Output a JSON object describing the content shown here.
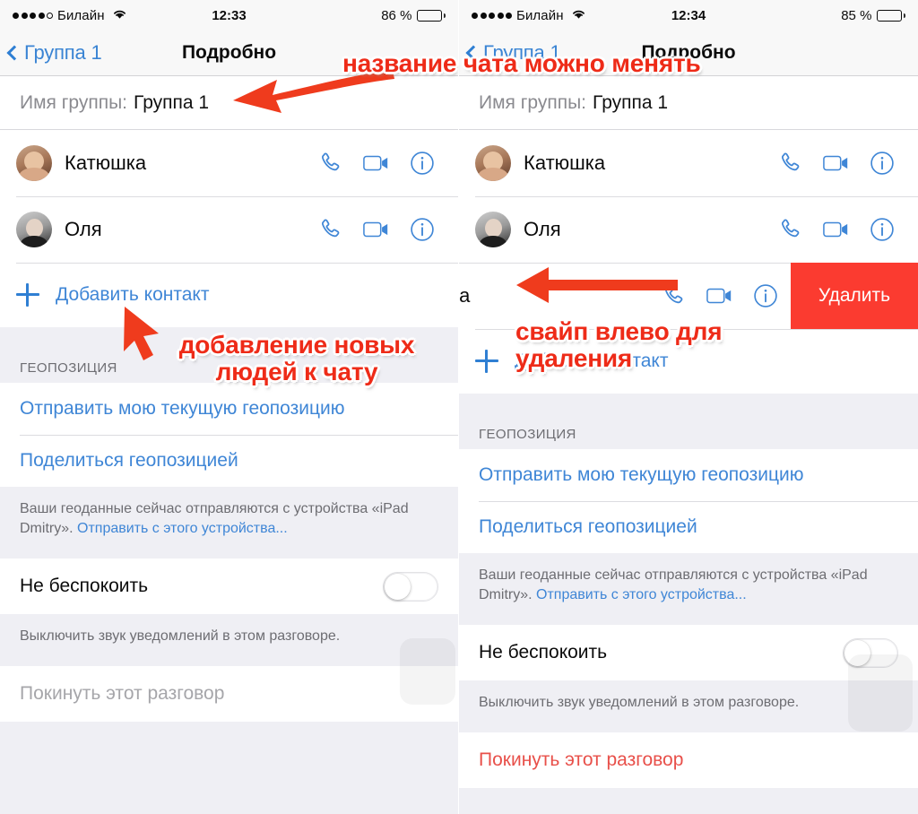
{
  "app": {
    "title": "Подробно"
  },
  "panels": [
    {
      "id": "left",
      "status": {
        "carrier": "Билайн",
        "signal_dots_filled": 4,
        "signal_dots_total": 5,
        "time": "12:33",
        "battery_percent": "86 %",
        "battery_level": 86,
        "wifi_icon": "wifi-icon"
      },
      "nav": {
        "back_label": "Группа 1",
        "title": "Подробно"
      },
      "group_name": {
        "label": "Имя группы:",
        "value": "Группа 1"
      },
      "contacts": [
        {
          "name": "Катюшка",
          "avatar": "avatar-katyushka",
          "actions": [
            "phone-icon",
            "video-camera-icon",
            "info-icon"
          ]
        },
        {
          "name": "Оля",
          "avatar": "avatar-olya",
          "actions": [
            "phone-icon",
            "video-camera-icon",
            "info-icon"
          ]
        }
      ],
      "add_contact_label": "Добавить контакт",
      "location_section_header": "ГЕОПОЗИЦИЯ",
      "location_links": [
        "Отправить мою текущую геопозицию",
        "Поделиться геопозицией"
      ],
      "location_footnote_before": "Ваши геоданные сейчас отправляются с устройства «iPad Dmitry». ",
      "location_footnote_link": "Отправить с этого устройства...",
      "dnd": {
        "label": "Не беспокоить",
        "enabled": false
      },
      "dnd_footnote": "Выключить звук уведомлений в этом разговоре.",
      "leave_label": "Покинуть этот разговор",
      "leave_state": "disabled"
    },
    {
      "id": "right",
      "status": {
        "carrier": "Билайн",
        "signal_dots_filled": 5,
        "signal_dots_total": 5,
        "time": "12:34",
        "battery_percent": "85 %",
        "battery_level": 85,
        "wifi_icon": "wifi-icon"
      },
      "nav": {
        "back_label": "Группа 1",
        "title": "Подробно"
      },
      "group_name": {
        "label": "Имя группы:",
        "value": "Группа 1"
      },
      "contacts": [
        {
          "name": "Катюшка",
          "avatar": "avatar-katyushka",
          "actions": [
            "phone-icon",
            "video-camera-icon",
            "info-icon"
          ]
        },
        {
          "name": "Оля",
          "avatar": "avatar-olya",
          "actions": [
            "phone-icon",
            "video-camera-icon",
            "info-icon"
          ]
        }
      ],
      "swiped_row": {
        "visible_name_fragment": "ка",
        "delete_label": "Удалить",
        "actions": [
          "phone-icon",
          "video-camera-icon",
          "info-icon"
        ]
      },
      "add_contact_label": "Добавить контакт",
      "location_section_header": "ГЕОПОЗИЦИЯ",
      "location_links": [
        "Отправить мою текущую геопозицию",
        "Поделиться геопозицией"
      ],
      "location_footnote_before": "Ваши геоданные сейчас отправляются с устройства «iPad Dmitry». ",
      "location_footnote_link": "Отправить с этого устройства...",
      "dnd": {
        "label": "Не беспокоить",
        "enabled": false
      },
      "dnd_footnote": "Выключить звук уведомлений в этом разговоре.",
      "leave_label": "Покинуть этот разговор",
      "leave_state": "active"
    }
  ],
  "annotations": [
    {
      "id": "title-editable",
      "text": "название чата можно менять"
    },
    {
      "id": "add-people",
      "line1": "добавление новых",
      "line2": "людей к чату"
    },
    {
      "id": "swipe-delete",
      "line1": "свайп влево для",
      "line2": "удаления"
    }
  ],
  "colors": {
    "accent_blue": "#3f86d6",
    "annotation_red": "#ee2b18",
    "delete_red": "#fb3b30",
    "leave_red": "#e8504a",
    "group_bg": "#efeff4",
    "separator": "#dcdce0"
  }
}
